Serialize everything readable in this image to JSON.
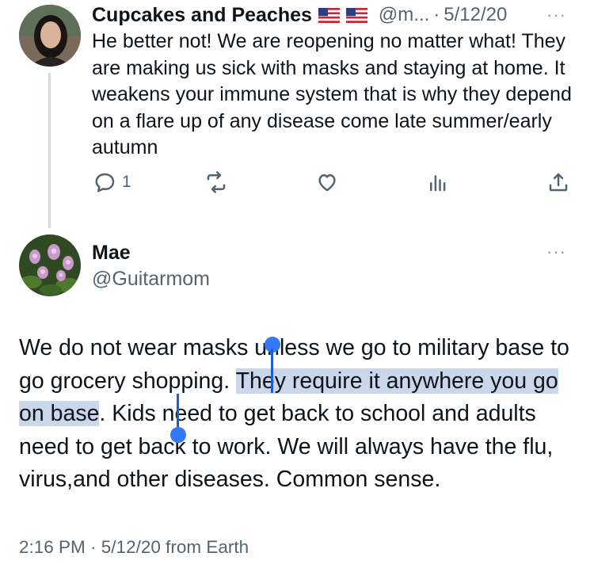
{
  "reply_tweet": {
    "author_name": "Cupcakes and Peaches",
    "handle": "@m...",
    "separator": "·",
    "date": "5/12/20",
    "more_label": "···",
    "text": "He better not! We are reopening no matter what! They are making us sick with masks and staying at home. It weakens your immune system that is why they depend on a flare up of any disease come late summer/early autumn",
    "actions": {
      "reply_count": "1",
      "reply_icon": "reply-icon",
      "retweet_icon": "retweet-icon",
      "like_icon": "heart-icon",
      "views_icon": "analytics-icon",
      "share_icon": "share-icon"
    },
    "flags": [
      "us-flag-icon",
      "us-flag-icon"
    ]
  },
  "main_tweet": {
    "author_name": "Mae",
    "handle": "@Guitarmom",
    "more_label": "···",
    "text_before": "We do not wear masks unless we go to military base to go grocery shopping. ",
    "text_selected": "They require it anywhere you go on base",
    "text_after": ". Kids need to get back to school and adults need to get back to work. We will always have the flu, virus,and other diseases. Common sense.",
    "timestamp": "2:16 PM · 5/12/20 from Earth"
  },
  "colors": {
    "text": "#0f1419",
    "muted": "#536471",
    "selection": "#cad7ea",
    "selection_handle": "#3478f6",
    "thread_line": "#cfd9de"
  }
}
